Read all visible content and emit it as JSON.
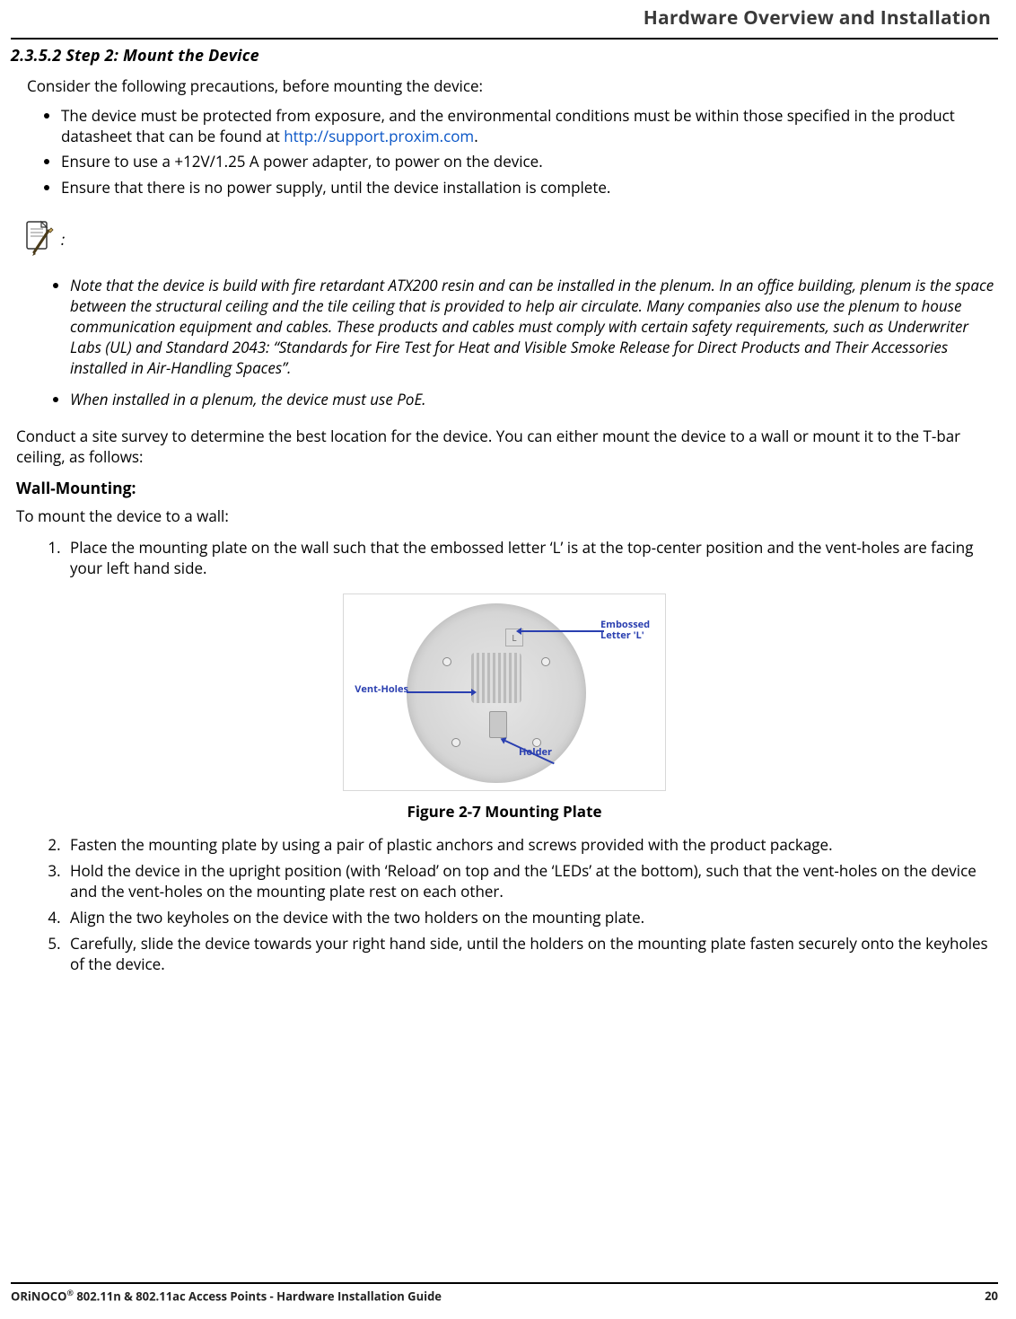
{
  "header": {
    "title": "Hardware Overview and Installation"
  },
  "section": {
    "number_title": "2.3.5.2 Step 2: Mount the Device",
    "intro": "Consider the following precautions, before mounting the device:",
    "bullets": [
      {
        "pre": "The device must be protected from exposure, and the environmental conditions must be within those specified in the product datasheet that can be found at ",
        "link": "http://support.proxim.com",
        "post": "."
      },
      {
        "text": "Ensure to use a +12V/1.25 A power adapter, to power on the device."
      },
      {
        "text": "Ensure that there is no power supply, until the device installation is complete."
      }
    ]
  },
  "note": {
    "colon": ":",
    "items": [
      "Note that the device is build with fire retardant ATX200 resin and can be installed in the plenum. In an office building, plenum is the space between the structural ceiling and the tile ceiling that is provided to help air circulate. Many companies also use the plenum to house communication equipment and cables. These products and cables must comply with certain safety requirements, such as Underwriter Labs (UL) and Standard 2043: “Standards for Fire Test for Heat and Visible Smoke Release for Direct Products and Their Accessories installed in Air-Handling Spaces”.",
      "When installed in a plenum, the device must use PoE."
    ]
  },
  "survey_para": "Conduct a site survey to determine the best location for the device. You can either mount the device to a wall or mount it to the T-bar ceiling, as follows:",
  "wall": {
    "heading": "Wall-Mounting:",
    "intro": "To mount the device to a wall:",
    "step1": "Place the mounting plate on the wall such that the embossed letter ‘L’ is at the top-center position and the vent-holes are facing your left hand side.",
    "steps_rest": [
      "Fasten the mounting plate by using a pair of plastic anchors and screws provided with the product package.",
      "Hold the device in the upright position (with ‘Reload’ on top and the ‘LEDs’ at the bottom), such that the vent-holes on the device and the vent-holes on the mounting plate rest on each other.",
      "Align the two keyholes on the device with the two holders on the mounting plate.",
      "Carefully, slide the device towards your right hand side, until the holders on the mounting plate fasten securely onto the keyholes of the device."
    ]
  },
  "figure": {
    "caption": "Figure 2-7 Mounting Plate",
    "callouts": {
      "embossed": "Embossed Letter 'L'",
      "ventholes": "Vent-Holes",
      "holder": "Holder"
    }
  },
  "footer": {
    "left_pre": "ORiNOCO",
    "left_sup": "®",
    "left_post": " 802.11n & 802.11ac Access Points - Hardware Installation Guide",
    "page": "20"
  }
}
